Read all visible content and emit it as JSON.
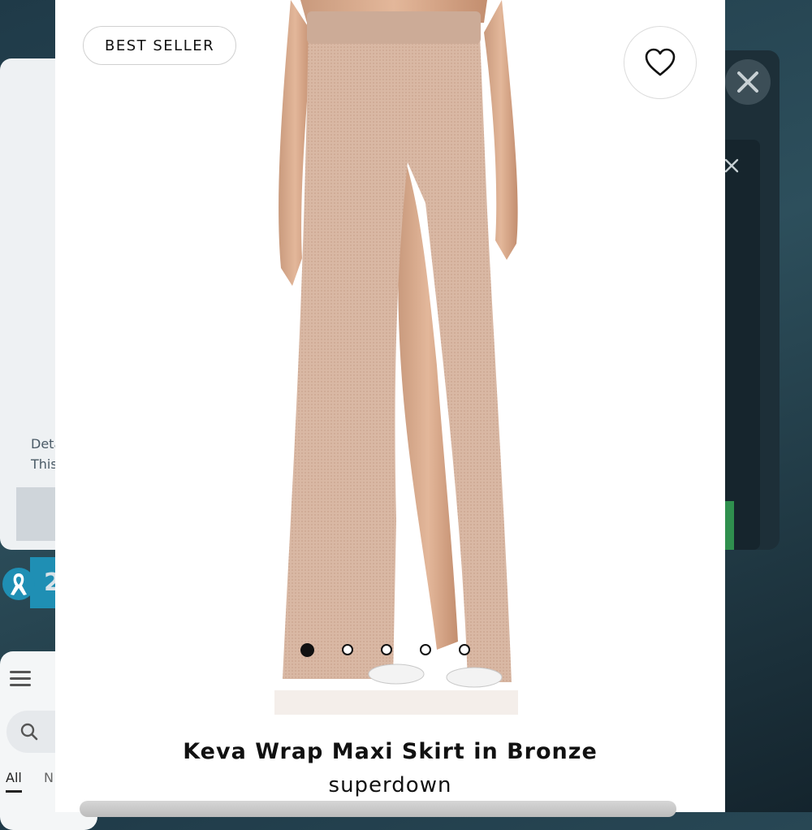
{
  "background": {
    "left_panel": {
      "detail_line1": "Deta",
      "detail_line2": "This",
      "ribbon_number": "2"
    },
    "bottom_panel": {
      "tab_all": "All",
      "tab_n": "N"
    }
  },
  "modal": {
    "badge": "BEST SELLER",
    "favorite_icon": "heart-outline-icon",
    "carousel": {
      "total": 5,
      "active": 1
    },
    "product": {
      "title": "Keva Wrap Maxi Skirt in Bronze",
      "brand": "superdown"
    }
  },
  "colors": {
    "accent_teal": "#1f8fb4",
    "skirt_bronze": "#d9b8a4"
  }
}
